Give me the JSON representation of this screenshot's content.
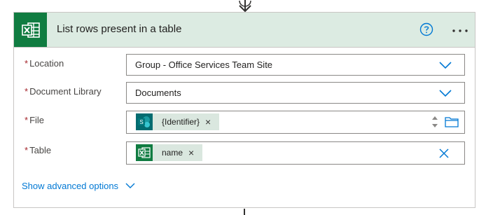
{
  "header": {
    "title": "List rows present in a table",
    "app_icon": "excel-icon",
    "help_icon": "help-circle-icon",
    "more_icon": "more-options-icon",
    "accent_color": "#107c41",
    "header_bg": "#dcebe2"
  },
  "fields": {
    "location": {
      "required_marker": "*",
      "label": "Location",
      "value": "Group - Office Services Team Site"
    },
    "document_library": {
      "required_marker": "*",
      "label": "Document Library",
      "value": "Documents"
    },
    "file": {
      "required_marker": "*",
      "label": "File",
      "token": {
        "label": "{Identifier}",
        "remove": "×",
        "icon": "sharepoint-icon"
      }
    },
    "table": {
      "required_marker": "*",
      "label": "Table",
      "token": {
        "label": "name",
        "remove": "×",
        "icon": "excel-icon"
      }
    }
  },
  "advanced": {
    "link_label": "Show advanced options"
  },
  "colors": {
    "link": "#0078d4",
    "required": "#a4262c",
    "token_bg": "#dae7df"
  }
}
